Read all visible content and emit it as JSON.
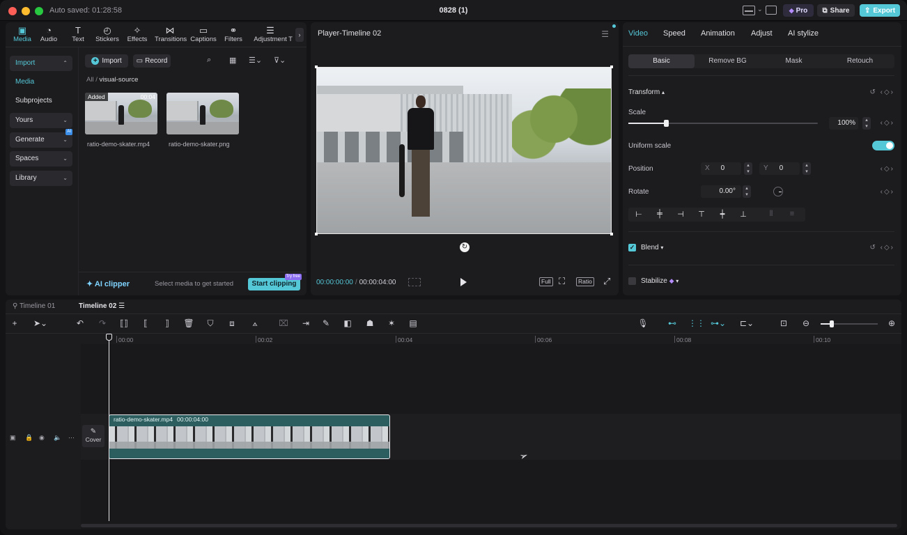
{
  "app": {
    "auto_saved": "Auto saved: 01:28:58",
    "title": "0828 (1)",
    "pro_label": "Pro",
    "share_label": "Share",
    "export_label": "Export",
    "accent_color": "#55c8d8"
  },
  "media_toolbar": {
    "tabs": [
      {
        "label": "Media",
        "icon": "media-icon"
      },
      {
        "label": "Audio",
        "icon": "audio-icon"
      },
      {
        "label": "Text",
        "icon": "text-icon"
      },
      {
        "label": "Stickers",
        "icon": "stickers-icon"
      },
      {
        "label": "Effects",
        "icon": "effects-icon"
      },
      {
        "label": "Transitions",
        "icon": "transitions-icon"
      },
      {
        "label": "Captions",
        "icon": "captions-icon"
      },
      {
        "label": "Filters",
        "icon": "filters-icon"
      },
      {
        "label": "Adjustment",
        "icon": "adjustment-icon"
      }
    ],
    "overflow_label": "T"
  },
  "media_sidebar": {
    "import": "Import",
    "media": "Media",
    "subprojects": "Subprojects",
    "yours": "Yours",
    "generate": "Generate",
    "generate_badge": "AI",
    "spaces": "Spaces",
    "library": "Library"
  },
  "media_main": {
    "import_btn": "Import",
    "record_btn": "Record",
    "breadcrumb_root": "All",
    "breadcrumb_sep": "/",
    "breadcrumb_folder": "visual-source",
    "items": [
      {
        "name": "ratio-demo-skater.mp4",
        "badge": "Added",
        "duration": "00:04"
      },
      {
        "name": "ratio-demo-skater.png"
      }
    ]
  },
  "ai_bar": {
    "title": "AI clipper",
    "hint": "Select media to get started",
    "button": "Start clipping",
    "button_badge": "Try free"
  },
  "player": {
    "title": "Player-Timeline 02",
    "current_time": "00:00:00:00",
    "separator": "/",
    "total_time": "00:00:04:00",
    "full_label": "Full",
    "ratio_label": "Ratio"
  },
  "inspector": {
    "tabs": [
      "Video",
      "Speed",
      "Animation",
      "Adjust",
      "AI stylize"
    ],
    "subtabs": [
      "Basic",
      "Remove BG",
      "Mask",
      "Retouch"
    ],
    "transform_label": "Transform",
    "scale_label": "Scale",
    "scale_value": "100%",
    "scale_fraction": 0.2,
    "uniform_scale_label": "Uniform scale",
    "uniform_scale_on": true,
    "position_label": "Position",
    "pos_x_prefix": "X",
    "pos_x": "0",
    "pos_y_prefix": "Y",
    "pos_y": "0",
    "rotate_label": "Rotate",
    "rotate_value": "0.00°",
    "blend_label": "Blend",
    "blend_checked": true,
    "stabilize_label": "Stabilize",
    "stabilize_checked": false
  },
  "timeline": {
    "tabs": [
      "Timeline 01",
      "Timeline 02"
    ],
    "ruler": [
      "00:00",
      "00:02",
      "00:04",
      "00:06",
      "00:08",
      "00:10"
    ],
    "cover_label": "Cover",
    "clip_name": "ratio-demo-skater.mp4",
    "clip_duration": "00:00:04:00",
    "zoom_fraction": 0.2
  }
}
